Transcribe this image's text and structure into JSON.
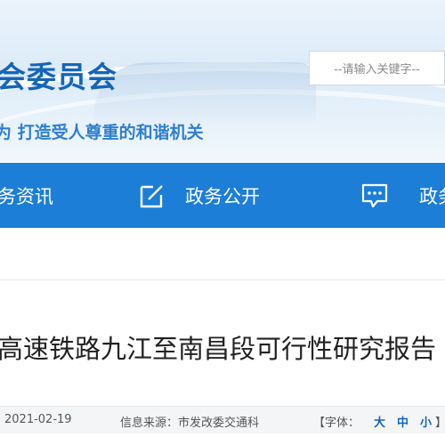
{
  "header": {
    "site_title": "会委员会",
    "slogan": "为 打造受人尊重的和谐机关",
    "search_placeholder": "--请输入关键字--"
  },
  "nav": {
    "items": [
      {
        "label": "务资讯",
        "icon": null
      },
      {
        "label": "政务公开",
        "icon": "edit-square-icon"
      },
      {
        "label": "政务",
        "icon": "chat-bubble-icon"
      }
    ]
  },
  "article": {
    "title": "高速铁路九江至南昌段可行性研究报告"
  },
  "meta": {
    "date": "2021-02-19",
    "source_label": "信息来源：",
    "source": "市发改委交通科",
    "font_label": "【字体：",
    "size_large": "大",
    "size_medium": "中",
    "size_small": "小",
    "font_close": "】"
  },
  "colors": {
    "nav_bg": "#1c7ed6",
    "title_blue": "#1565b8",
    "slogan_blue": "#2e7fd0"
  }
}
